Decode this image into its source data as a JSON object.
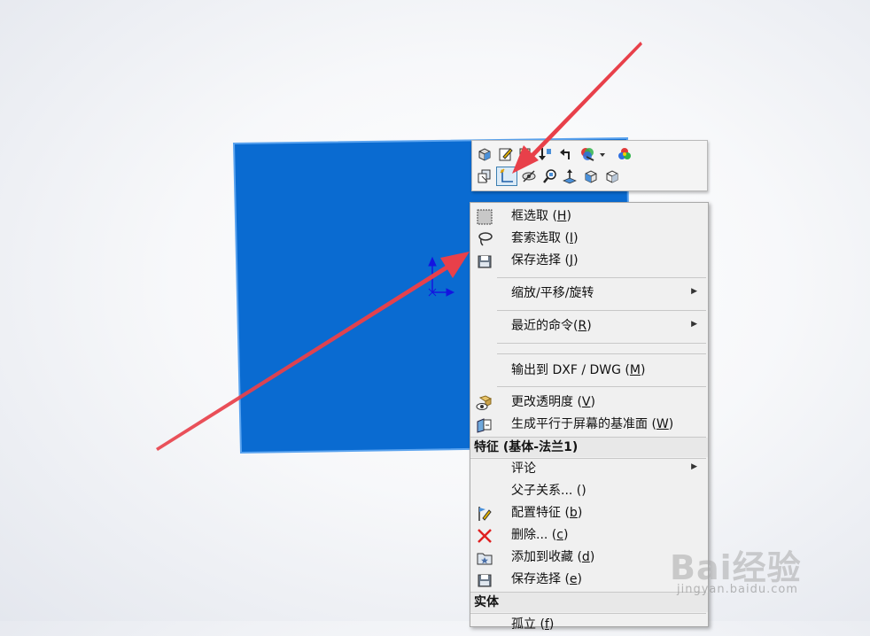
{
  "colors": {
    "part_blue": "#0a6bd1",
    "part_edge": "#5aa3ef",
    "arrow_red": "#e8404a",
    "triad_blue": "#1414e0"
  },
  "toolbar": {
    "row1_icons": [
      "normal-to-icon",
      "edit-sketch-icon",
      "edit-feature-icon",
      "rollback-icon",
      "undo-icon",
      "appearance-icon",
      "dropdown-icon",
      "edit-appearance-icon"
    ],
    "row2_icons": [
      "select-other-icon",
      "sketch-icon",
      "hide-icon",
      "zoom-to-selection-icon",
      "normal-view-icon",
      "isolate-icon",
      "view-cube-icon"
    ]
  },
  "menu": {
    "box_select": {
      "label": "框选取 (",
      "key": "H",
      "close": ")"
    },
    "lasso_select": {
      "label": "套索选取 (",
      "key": "I",
      "close": ")"
    },
    "save_selection": {
      "label": "保存选择 (",
      "key": "J",
      "close": ")"
    },
    "zoom_pan_rotate": {
      "label": "缩放/平移/旋转"
    },
    "recent_commands": {
      "label": "最近的命令(",
      "key": "R",
      "close": ")"
    },
    "export_dxf": {
      "label": "输出到 DXF / DWG (",
      "key": "M",
      "close": ")"
    },
    "change_transparency": {
      "label": "更改透明度 (",
      "key": "V",
      "close": ")"
    },
    "plane_parallel": {
      "label": "生成平行于屏幕的基准面 (",
      "key": "W",
      "close": ")"
    },
    "feature_header": "特征 (基体-法兰1)",
    "comment": {
      "label": "评论"
    },
    "parent_child": {
      "label": "父子关系... (",
      "key": "",
      "close": ")"
    },
    "config_feature": {
      "label": "配置特征 (",
      "key": "b",
      "close": ")"
    },
    "delete": {
      "label": "删除... (",
      "key": "c",
      "close": ")"
    },
    "add_favorite": {
      "label": "添加到收藏 (",
      "key": "d",
      "close": ")"
    },
    "save_selection2": {
      "label": "保存选择 (",
      "key": "e",
      "close": ")"
    },
    "body_header": "实体",
    "isolate": {
      "label": "孤立 (",
      "key": "f",
      "close": ")"
    }
  },
  "watermark": {
    "brand": "Bai经验",
    "url": "jingyan.baidu.com"
  }
}
